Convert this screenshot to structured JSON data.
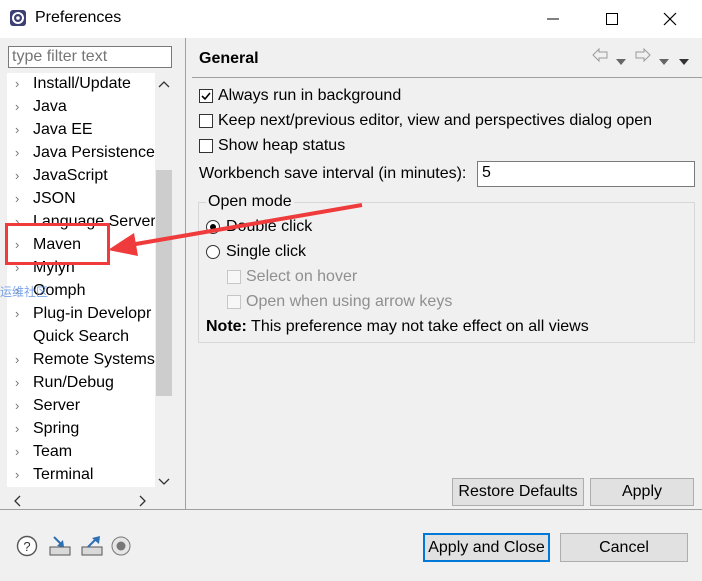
{
  "window": {
    "title": "Preferences",
    "controls": [
      "minimize",
      "maximize",
      "close"
    ]
  },
  "sidebar": {
    "filter_placeholder": "type filter text",
    "items": [
      {
        "label": "Install/Update",
        "has_children": true
      },
      {
        "label": "Java",
        "has_children": true
      },
      {
        "label": "Java EE",
        "has_children": true
      },
      {
        "label": "Java Persistence",
        "has_children": true
      },
      {
        "label": "JavaScript",
        "has_children": true
      },
      {
        "label": "JSON",
        "has_children": true
      },
      {
        "label": "Language Server",
        "has_children": true
      },
      {
        "label": "Maven",
        "has_children": true,
        "highlighted": true
      },
      {
        "label": "Mylyn",
        "has_children": true
      },
      {
        "label": "Oomph",
        "has_children": true
      },
      {
        "label": "Plug-in Developr",
        "has_children": true
      },
      {
        "label": "Quick Search",
        "has_children": false
      },
      {
        "label": "Remote Systems",
        "has_children": true
      },
      {
        "label": "Run/Debug",
        "has_children": true
      },
      {
        "label": "Server",
        "has_children": true
      },
      {
        "label": "Spring",
        "has_children": true
      },
      {
        "label": "Team",
        "has_children": true
      },
      {
        "label": "Terminal",
        "has_children": true
      }
    ],
    "scroll_up": "^",
    "scroll_down": "v",
    "scroll_left": "<",
    "scroll_right": ">"
  },
  "main": {
    "title": "General",
    "options": {
      "always_background": {
        "label": "Always run in background",
        "checked": true
      },
      "keep_next_prev": {
        "label": "Keep next/previous editor, view and perspectives dialog open",
        "checked": false
      },
      "show_heap": {
        "label": "Show heap status",
        "checked": false
      }
    },
    "workbench_interval": {
      "label": "Workbench save interval (in minutes):",
      "value": "5"
    },
    "open_mode": {
      "group_label": "Open mode",
      "double_click": {
        "label": "Double click",
        "selected": true
      },
      "single_click": {
        "label": "Single click",
        "selected": false
      },
      "select_on_hover": {
        "label": "Select on hover",
        "checked": false,
        "enabled": false
      },
      "open_arrow_keys": {
        "label": "Open when using arrow keys",
        "checked": false,
        "enabled": false
      },
      "note_bold": "Note:",
      "note_text": "This preference may not take effect on all views"
    },
    "restore_defaults": "Restore Defaults",
    "apply": "Apply"
  },
  "footer": {
    "apply_close": "Apply and Close",
    "cancel": "Cancel",
    "icons": [
      "help-icon",
      "import-icon",
      "export-icon",
      "record-icon"
    ]
  },
  "annotation": {
    "color": "#ef3b3b",
    "watermark": "运维社区"
  }
}
